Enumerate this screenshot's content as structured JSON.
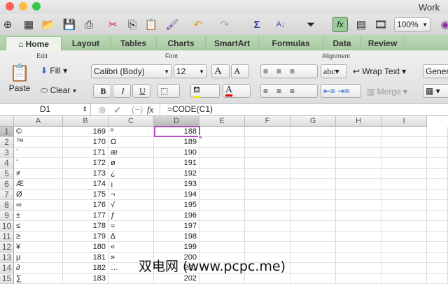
{
  "window": {
    "title": "Work"
  },
  "toolbar": {
    "zoom": "100%"
  },
  "tabs": [
    {
      "label": "Home"
    },
    {
      "label": "Layout"
    },
    {
      "label": "Tables"
    },
    {
      "label": "Charts"
    },
    {
      "label": "SmartArt"
    },
    {
      "label": "Formulas"
    },
    {
      "label": "Data"
    },
    {
      "label": "Review"
    }
  ],
  "ribbon": {
    "edit": "Edit",
    "font": "Font",
    "alignment": "Alignment",
    "paste": "Paste",
    "fill": "Fill",
    "clear": "Clear",
    "font_name": "Calibri (Body)",
    "font_size": "12",
    "bold": "B",
    "italic": "I",
    "underline": "U",
    "abc": "abc",
    "wrap_text": "Wrap Text",
    "merge": "Merge",
    "number_format": "Gener",
    "grow": "A",
    "shrink": "A",
    "font_color": "A"
  },
  "formula_bar": {
    "cell_ref": "D1",
    "fx": "fx",
    "formula": "=CODE(C1)"
  },
  "columns": [
    "A",
    "B",
    "C",
    "D",
    "E",
    "F",
    "G",
    "H",
    "I"
  ],
  "rows": [
    [
      "©",
      "169",
      "º",
      "188"
    ],
    [
      "™",
      "170",
      "Ω",
      "189"
    ],
    [
      "´",
      "171",
      "æ",
      "190"
    ],
    [
      "¨",
      "172",
      "ø",
      "191"
    ],
    [
      "≠",
      "173",
      "¿",
      "192"
    ],
    [
      "Æ",
      "174",
      "¡",
      "193"
    ],
    [
      "Ø",
      "175",
      "¬",
      "194"
    ],
    [
      "∞",
      "176",
      "√",
      "195"
    ],
    [
      "±",
      "177",
      "ƒ",
      "196"
    ],
    [
      "≤",
      "178",
      "≈",
      "197"
    ],
    [
      "≥",
      "179",
      "∆",
      "198"
    ],
    [
      "¥",
      "180",
      "«",
      "199"
    ],
    [
      "µ",
      "181",
      "»",
      "200"
    ],
    [
      "∂",
      "182",
      "…",
      "201"
    ],
    [
      "∑",
      "183",
      "",
      "202"
    ]
  ],
  "watermark": "双电网 (www.pcpc.me)",
  "colors": {
    "selection": "#b04fc0",
    "tabbar": "#b5d3af"
  }
}
